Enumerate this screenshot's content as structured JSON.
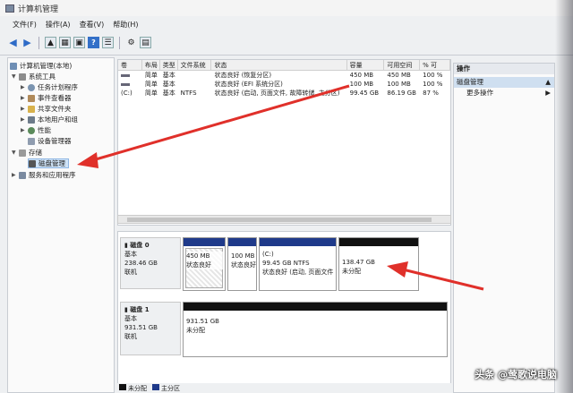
{
  "window": {
    "title": "计算机管理"
  },
  "menu": [
    "文件(F)",
    "操作(A)",
    "查看(V)",
    "帮助(H)"
  ],
  "tree": {
    "root": "计算机管理(本地)",
    "system_tools": "系统工具",
    "task_scheduler": "任务计划程序",
    "event_viewer": "事件查看器",
    "shared_folders": "共享文件夹",
    "local_users": "本地用户和组",
    "performance": "性能",
    "device_manager": "设备管理器",
    "storage": "存储",
    "disk_management": "磁盘管理",
    "services": "服务和应用程序"
  },
  "volumes": {
    "headers": [
      "卷",
      "布局",
      "类型",
      "文件系统",
      "状态",
      "容量",
      "可用空间",
      "% 可"
    ],
    "rows": [
      [
        "",
        "简单",
        "基本",
        "",
        "状态良好 (恢复分区)",
        "450 MB",
        "450 MB",
        "100 %"
      ],
      [
        "",
        "简单",
        "基本",
        "",
        "状态良好 (EFI 系统分区)",
        "100 MB",
        "100 MB",
        "100 %"
      ],
      [
        "(C:)",
        "简单",
        "基本",
        "NTFS",
        "状态良好 (启动, 页面文件, 故障转储, 主分区)",
        "99.45 GB",
        "86.19 GB",
        "87 %"
      ]
    ]
  },
  "disks": {
    "disk0": {
      "name": "磁盘 0",
      "type": "基本",
      "size": "238.46 GB",
      "status": "联机",
      "partitions": [
        {
          "size": "450 MB",
          "status": "状态良好"
        },
        {
          "size": "100 MB",
          "status": "状态良好"
        },
        {
          "label": "(C:)",
          "size": "99.45 GB NTFS",
          "status": "状态良好 (启动, 页面文件"
        },
        {
          "size": "138.47 GB",
          "status": "未分配"
        }
      ]
    },
    "disk1": {
      "name": "磁盘 1",
      "type": "基本",
      "size": "931.51 GB",
      "status": "联机",
      "partition": {
        "size": "931.51 GB",
        "status": "未分配"
      }
    }
  },
  "legend": [
    "未分配",
    "主分区"
  ],
  "actions": {
    "header": "操作",
    "section": "磁盘管理",
    "more": "更多操作"
  },
  "watermark": "头条 @莺歌说电脑",
  "colors": {
    "primary_partition": "#1f3a8a",
    "unallocated": "#111111",
    "arrow": "#e0302a",
    "selected": "#cfe3f7"
  }
}
